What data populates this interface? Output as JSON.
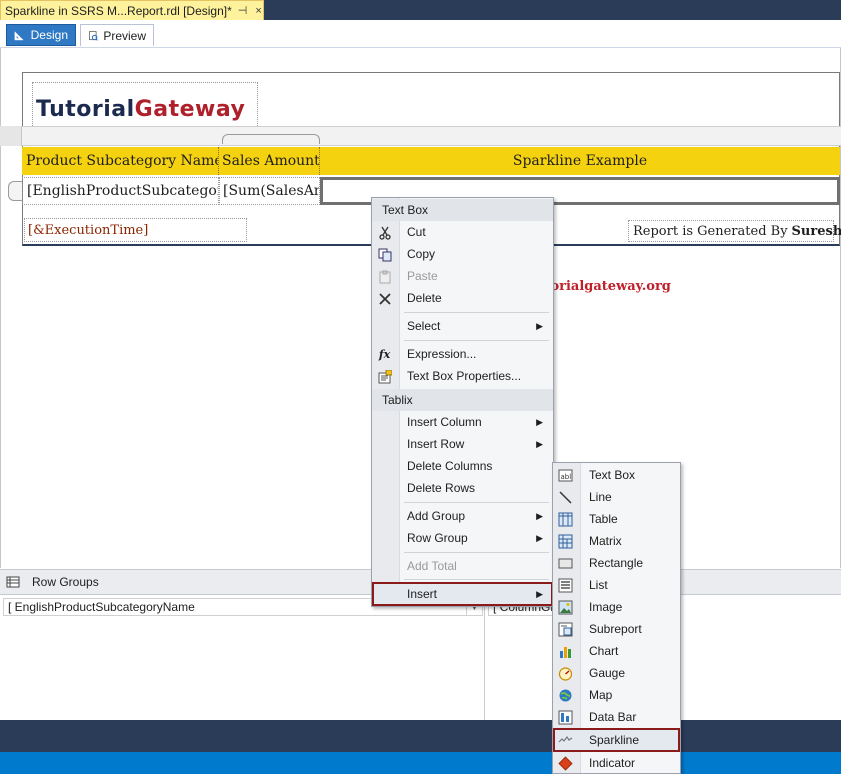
{
  "document_tab": {
    "title": "Sparkline in SSRS M...Report.rdl [Design]*",
    "pin": "⊣",
    "close": "×"
  },
  "view_tabs": {
    "design": "Design",
    "preview": "Preview"
  },
  "report": {
    "logo_part1": "Tutorial",
    "logo_part2": "Gateway",
    "header": {
      "col1": "Product Subcategory Name",
      "col2": "Sales Amount",
      "col3": "Sparkline Example"
    },
    "detail": {
      "col1": "[EnglishProductSubcategor",
      "col2": "[Sum(SalesAm"
    },
    "execution_time": "[&ExecutionTime]",
    "generated_by_prefix": "Report is Generated By",
    "generated_by_name": "Suresh"
  },
  "watermark": "©tutorialgateway.org",
  "groups_pane": {
    "row_groups_label": "Row Groups",
    "row_group_item": "[ EnglishProductSubcategoryName",
    "column_group_item": "[ ColumnGr"
  },
  "context_menu": {
    "section_textbox": "Text Box",
    "cut": "Cut",
    "copy": "Copy",
    "paste": "Paste",
    "delete": "Delete",
    "select": "Select",
    "expression": "Expression...",
    "textbox_properties": "Text Box Properties...",
    "section_tablix": "Tablix",
    "insert_column": "Insert Column",
    "insert_row": "Insert Row",
    "delete_columns": "Delete Columns",
    "delete_rows": "Delete Rows",
    "add_group": "Add Group",
    "row_group": "Row Group",
    "add_total": "Add Total",
    "insert": "Insert"
  },
  "insert_submenu": {
    "textbox": "Text Box",
    "line": "Line",
    "table": "Table",
    "matrix": "Matrix",
    "rectangle": "Rectangle",
    "list": "List",
    "image": "Image",
    "subreport": "Subreport",
    "chart": "Chart",
    "gauge": "Gauge",
    "map": "Map",
    "databar": "Data Bar",
    "sparkline": "Sparkline",
    "indicator": "Indicator"
  },
  "colors": {
    "header_yellow": "#f5d20f",
    "highlight_border": "#8b1a1a",
    "vs_dark": "#2b3c59",
    "status_blue": "#007acc",
    "design_tab_blue": "#2f79c4",
    "watermark_red": "#c0202a"
  },
  "icons": {
    "cut": "scissors-icon",
    "copy": "copy-icon",
    "paste": "paste-icon",
    "delete": "x-icon",
    "expression": "fx-icon",
    "properties": "properties-icon"
  }
}
